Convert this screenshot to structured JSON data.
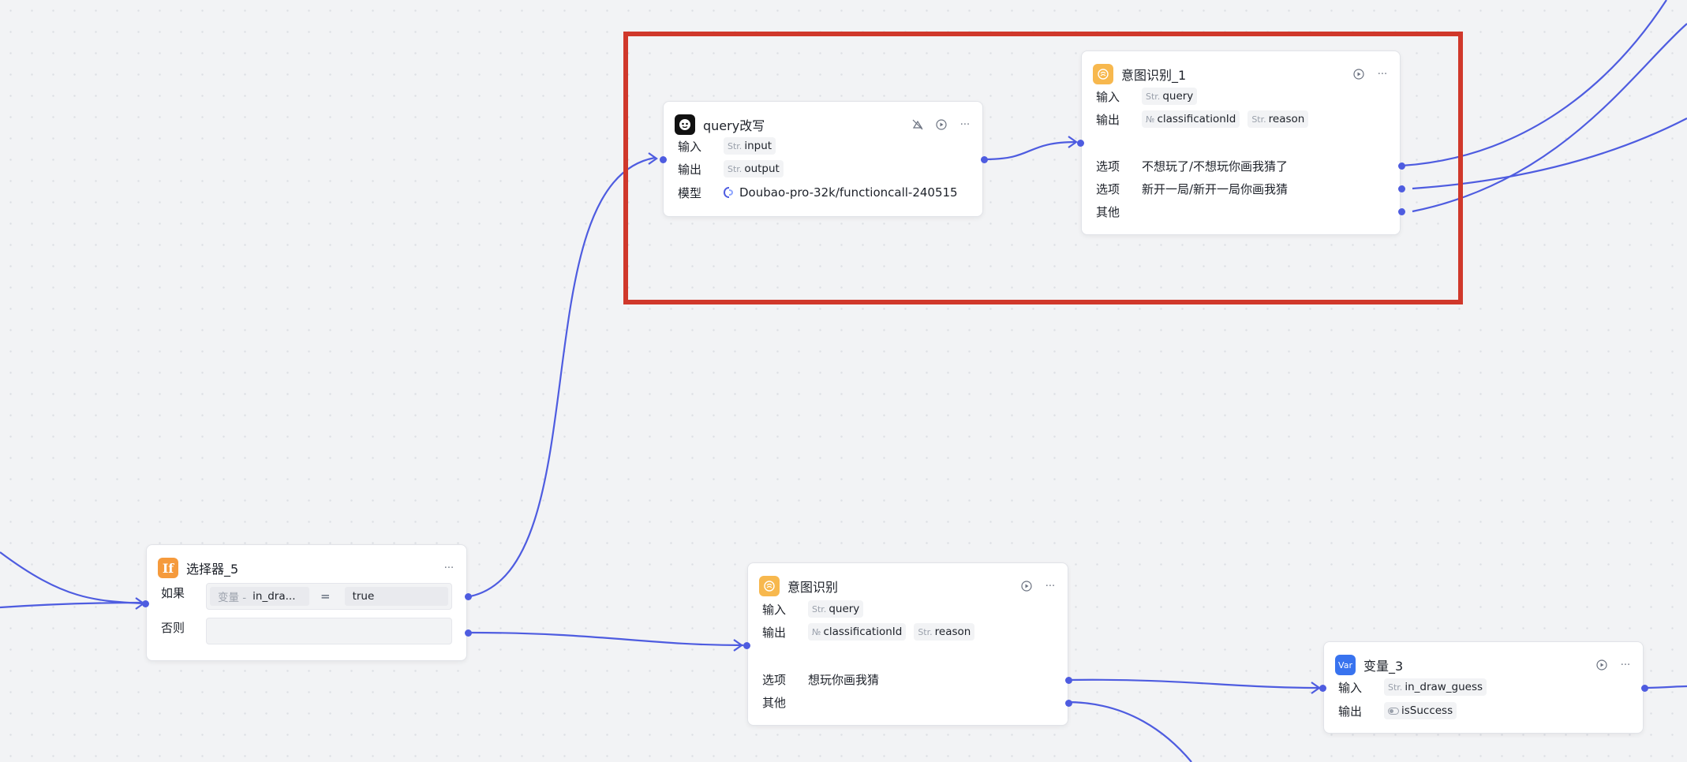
{
  "colors": {
    "edge": "#4e5ce0",
    "highlight": "#d0382b",
    "intent_icon": "#f7b84e",
    "if_icon": "#f59a3c",
    "var_icon": "#3873ef"
  },
  "icons": {
    "run": "play-circle-icon",
    "more": "ellipsis-icon",
    "skip": "skip-icon"
  },
  "query_node": {
    "title": "query改写",
    "input_label": "输入",
    "input_type": "Str.",
    "input_value": "input",
    "output_label": "输出",
    "output_type": "Str.",
    "output_value": "output",
    "model_label": "模型",
    "model_value": "Doubao-pro-32k/functioncall-240515"
  },
  "intent1_node": {
    "title": "意图识别_1",
    "input_label": "输入",
    "input_type": "Str.",
    "input_value": "query",
    "output_label": "输出",
    "output1_type": "№",
    "output1_value": "classificationId",
    "output2_type": "Str.",
    "output2_value": "reason",
    "option_label": "选项",
    "option1": "不想玩了/不想玩你画我猜了",
    "option2": "新开一局/新开一局你画我猜",
    "other_label": "其他"
  },
  "selector_node": {
    "icon_text": "If",
    "title": "选择器_5",
    "if_label": "如果",
    "cond_var_prefix": "变量 -",
    "cond_var": "in_dra...",
    "cond_op": "=",
    "cond_value": "true",
    "else_label": "否则"
  },
  "intent_node": {
    "title": "意图识别",
    "input_label": "输入",
    "input_type": "Str.",
    "input_value": "query",
    "output_label": "输出",
    "output1_type": "№",
    "output1_value": "classificationId",
    "output2_type": "Str.",
    "output2_value": "reason",
    "option_label": "选项",
    "option1": "想玩你画我猜",
    "other_label": "其他"
  },
  "var_node": {
    "icon_text": "Var",
    "title": "变量_3",
    "input_label": "输入",
    "input_type": "Str.",
    "input_value": "in_draw_guess",
    "output_label": "输出",
    "output_value": "isSuccess"
  }
}
